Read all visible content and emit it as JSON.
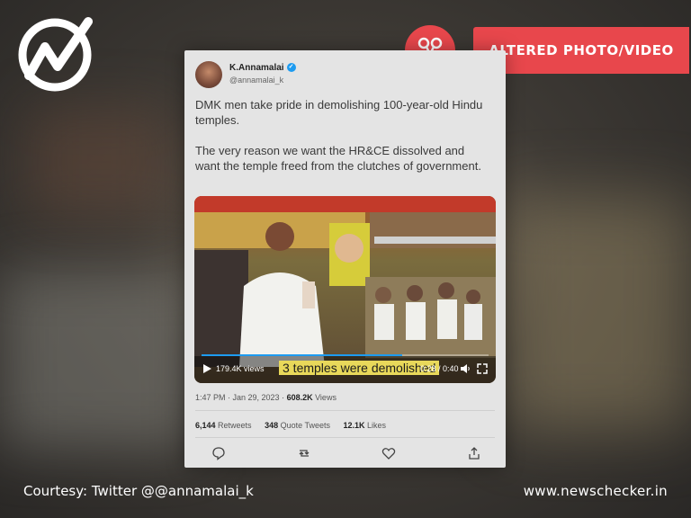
{
  "badge": {
    "label": "ALTERED PHOTO/VIDEO",
    "color": "#e8474c",
    "icon": "scissors-icon"
  },
  "brand": {
    "logo_icon": "newschecker-logo-icon"
  },
  "tweet": {
    "author_name": "K.Annamalai",
    "author_handle": "@annamalai_k",
    "paragraphs": [
      "DMK men take pride in demolishing 100-year-old Hindu temples.",
      "The very reason we want the HR&CE dissolved and want the temple freed from the clutches of government."
    ],
    "video": {
      "views_label": "179.4K views",
      "caption": "3 temples were demolished",
      "time": "0:28 / 0:40"
    },
    "timestamp": "1:47 PM · Jan 29, 2023 · ",
    "views_count": "608.2K",
    "views_word": " Views",
    "retweets_count": "6,144",
    "retweets_word": " Retweets",
    "quotes_count": "348",
    "quotes_word": " Quote Tweets",
    "likes_count": "12.1K",
    "likes_word": " Likes"
  },
  "footer": {
    "courtesy": "Courtesy: Twitter @@annamalai_k",
    "site": "www.newschecker.in"
  }
}
